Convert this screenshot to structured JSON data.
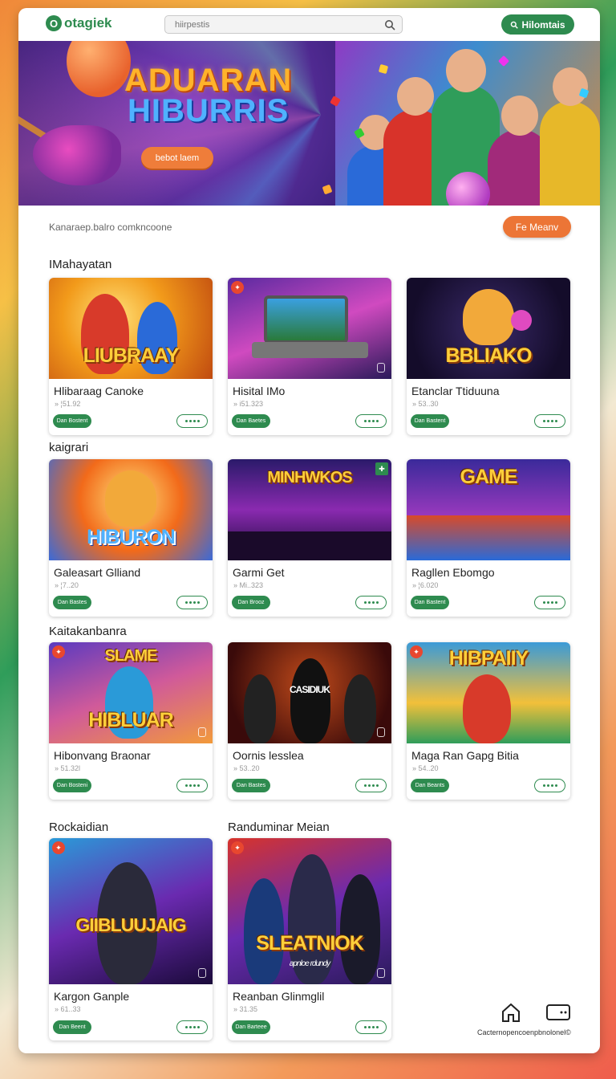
{
  "header": {
    "logo_text": "otagiek",
    "logo_mark": "O",
    "search_placeholder": "hiirpestis",
    "search_icon": "search-icon",
    "action_label": "Hilomtais",
    "action_icon": "search-icon"
  },
  "hero": {
    "title_line1": "ADUARAN",
    "title_line2": "HIBURRIS",
    "cta_label": "bebot laem"
  },
  "strip": {
    "text": "Kanaraep.balro comkncoone",
    "button_label": "Fe Meanv"
  },
  "sections": [
    {
      "title": "IMahayatan"
    },
    {
      "title": "kaigrari"
    },
    {
      "title": "Kaitakanbanra"
    },
    {
      "title": "Rockaidian"
    },
    {
      "title": "Randuminar Meian"
    }
  ],
  "cards": [
    {
      "name": "Hlibaraag Canoke",
      "meta": "» ¦51.92",
      "art": "LIUBRAAY",
      "play": "Dan Bostent"
    },
    {
      "name": "Hisital IMo",
      "meta": "» i51.323",
      "art": "",
      "play": "Dan Baetes"
    },
    {
      "name": "Etanclar Ttiduuna",
      "meta": "» 53..30",
      "art": "BBLIAKO",
      "play": "Dan Bastent"
    },
    {
      "name": "Galeasart Glliand",
      "meta": "» ¦7..20",
      "art": "HIBURON",
      "play": "Dan Bastes"
    },
    {
      "name": "Garmi Get",
      "meta": "» Mi..323",
      "art": "MINHWKOS",
      "play": "Dan Brooz"
    },
    {
      "name": "Ragllen Ebomgo",
      "meta": "» ¦6.020",
      "art": "GAME",
      "play": "Dan Bastent"
    },
    {
      "name": "Hibonvang Braonar",
      "meta": "» 51.32l",
      "art": "HIBLUAR",
      "play": "Dan Bosteni"
    },
    {
      "name": "Oornis lesslea",
      "meta": "» 53..20",
      "art": "CASIDIUK",
      "play": "Dan Bastes"
    },
    {
      "name": "Maga Ran Gapg Bitia",
      "meta": "» 54..20",
      "art": "HIBPAIIY",
      "play": "Dan Beants"
    },
    {
      "name": "Kargon Ganple",
      "meta": "» 61..33",
      "art": "GIIBLUUJAIG",
      "play": "Dan Beent"
    },
    {
      "name": "Reanban Glinmglil",
      "meta": "» 31.35",
      "art": "SLEATNIOK",
      "play": "Dan Barteee"
    }
  ],
  "hero_second_art": "SLAME",
  "art_subtitle": "apnloe rdundy",
  "bottom": {
    "caption": "Cacternopencoenpbnolonel©",
    "home_icon": "home-icon",
    "ticket_icon": "ticket-icon"
  }
}
